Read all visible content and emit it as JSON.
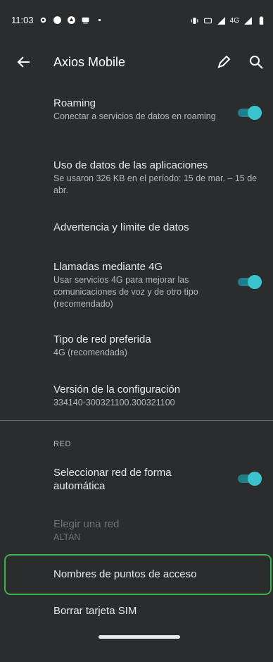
{
  "status": {
    "time": "11:03",
    "right_text": "4G"
  },
  "appbar": {
    "title": "Axios Mobile"
  },
  "items": [
    {
      "title": "Roaming",
      "subtitle": "Conectar a servicios de datos en roaming",
      "toggle": true
    },
    {
      "title": "Uso de datos de las aplicaciones",
      "subtitle": "Se usaron 326 KB en el período: 15 de mar. – 15 de abr."
    },
    {
      "title": "Advertencia y límite de datos"
    },
    {
      "title": "Llamadas mediante 4G",
      "subtitle": "Usar servicios 4G para mejorar las comunicaciones de voz y de otro tipo (recomendado)",
      "toggle": true
    },
    {
      "title": "Tipo de red preferida",
      "subtitle": "4G (recomendada)"
    },
    {
      "title": "Versión de la configuración",
      "subtitle": "334140-300321100.300321100"
    }
  ],
  "section_red": "RED",
  "red_items": [
    {
      "title": "Seleccionar red de forma automática",
      "toggle": true
    },
    {
      "title": "Elegir una red",
      "subtitle": "ALTAN",
      "disabled": true
    },
    {
      "title": "Nombres de puntos de acceso"
    },
    {
      "title": "Borrar tarjeta SIM"
    }
  ],
  "colors": {
    "background": "#2b2c2e",
    "toggle_on": "#39c4cf",
    "highlight": "#3fb14e"
  }
}
